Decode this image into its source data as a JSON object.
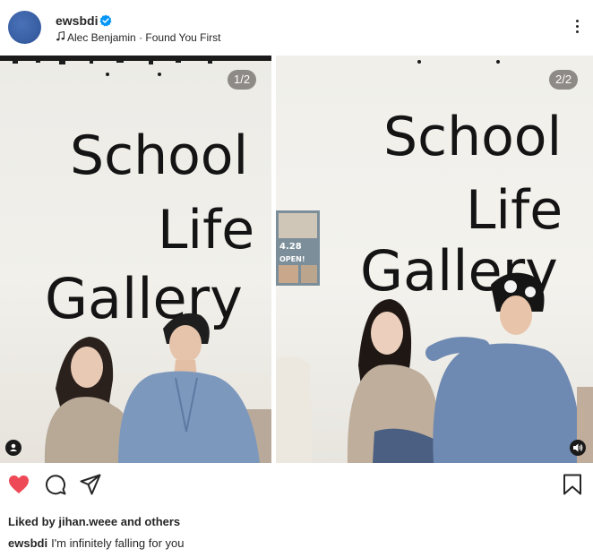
{
  "post": {
    "username": "ewsbdi",
    "audio": {
      "artist": "Alec Benjamin",
      "separator": "·",
      "song": "Found You First"
    }
  },
  "images": [
    {
      "counter": "1/2",
      "wall_text": [
        "School",
        "Life",
        "Gallery"
      ],
      "badge_icon": "user-tag-icon"
    },
    {
      "counter": "2/2",
      "wall_text": [
        "School",
        "Life",
        "Gallery"
      ],
      "poster_text": [
        "4.28",
        "OPEN!"
      ],
      "badge_icon": "speaker-icon"
    }
  ],
  "actions": {
    "like_icon": "heart-filled-icon",
    "comment_icon": "comment-icon",
    "share_icon": "send-icon",
    "save_icon": "bookmark-icon"
  },
  "likes": {
    "text": "Liked by jihan.weee and others"
  },
  "caption": {
    "username": "ewsbdi",
    "text": "I'm infinitely falling for you"
  },
  "colors": {
    "like_red": "#ed4956",
    "verified_blue": "#0095f6",
    "avatar_blue": "#3a5fa6",
    "text": "#262626"
  }
}
